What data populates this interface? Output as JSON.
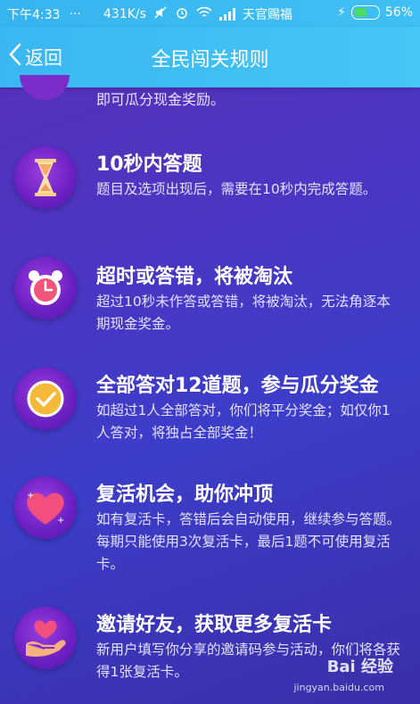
{
  "status_bar": {
    "time": "下午4:33",
    "speed": "431K/s",
    "carrier": "天官赐福",
    "battery": "56%"
  },
  "nav": {
    "back_label": "返回",
    "title": "全民闯关规则"
  },
  "partial_text": "即可瓜分现金奖励。",
  "rules": [
    {
      "title": "10秒内答题",
      "desc": "题目及选项出现后，需要在10秒内完成答题。",
      "icon": "hourglass-icon"
    },
    {
      "title": "超时或答错，将被淘汰",
      "desc": "超过10秒未作答或答错，将被淘汰，无法角逐本期现金奖金。",
      "icon": "alarm-clock-icon"
    },
    {
      "title": "全部答对12道题，参与瓜分奖金",
      "desc": "如超过1人全部答对，你们将平分奖金；如仅你1人答对，将独占全部奖金！",
      "icon": "check-circle-icon"
    },
    {
      "title": "复活机会，助你冲顶",
      "desc": "如有复活卡，答错后会自动使用，继续参与答题。每期只能使用3次复活卡，最后1题不可使用复活卡。",
      "icon": "heart-plus-icon"
    },
    {
      "title": "邀请好友，获取更多复活卡",
      "desc": "新用户填写你分享的邀请码参与活动，你们将各获得1张复活卡。",
      "icon": "hand-heart-icon"
    }
  ],
  "watermark": {
    "brand": "Bai 经验",
    "url": "jingyan.baidu.com"
  },
  "colors": {
    "navbar": "#3ab7f1",
    "background": "#4a36c2",
    "icon_bg": "#6a1fc2"
  }
}
